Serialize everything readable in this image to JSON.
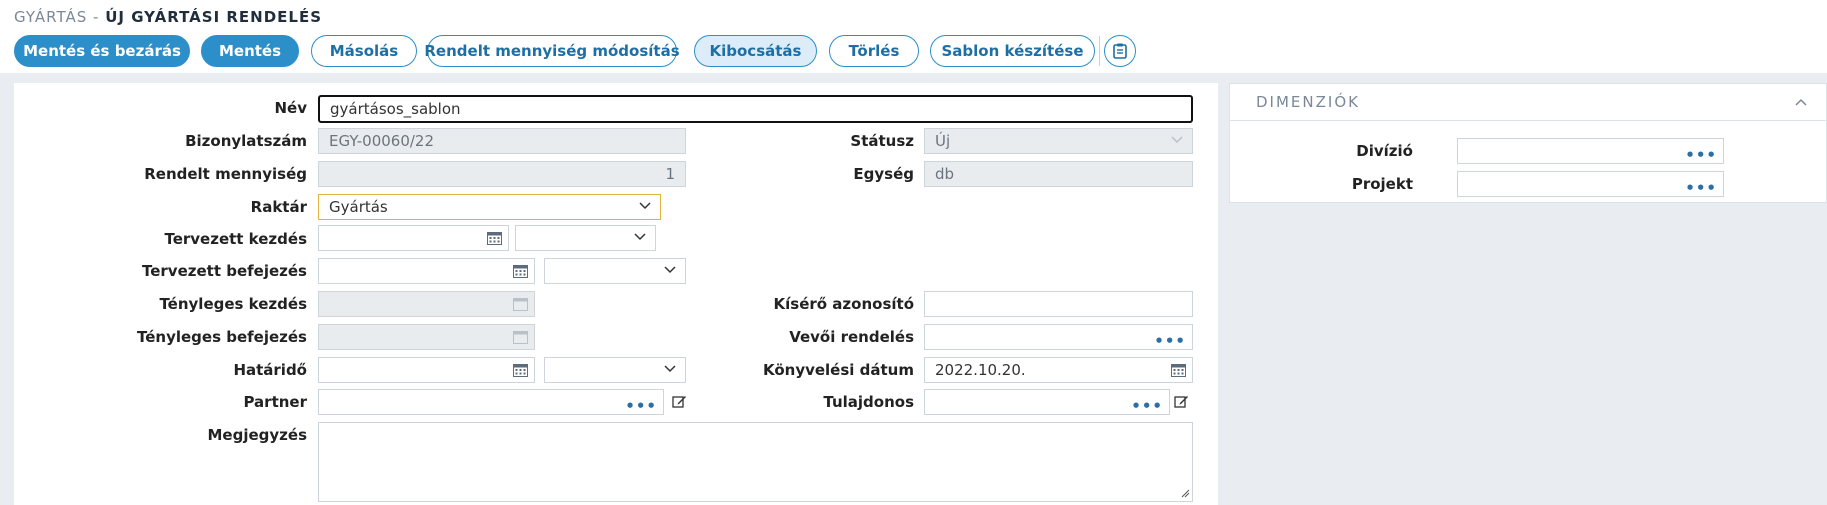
{
  "header": {
    "breadcrumb": "GYÁRTÁS -",
    "title": "ÚJ GYÁRTÁSI RENDELÉS"
  },
  "toolbar": {
    "save_close": "Mentés és bezárás",
    "save": "Mentés",
    "copy": "Másolás",
    "modify_qty": "Rendelt mennyiség módosítás",
    "issue": "Kibocsátás",
    "delete": "Törlés",
    "template": "Sablon készítése",
    "icon": "clipboard-icon"
  },
  "form": {
    "name": {
      "label": "Név",
      "value": "gyártásos_sablon"
    },
    "doc_number": {
      "label": "Bizonylatszám",
      "value": "EGY-00060/22"
    },
    "ordered_qty": {
      "label": "Rendelt mennyiség",
      "value": "1"
    },
    "warehouse": {
      "label": "Raktár",
      "value": "Gyártás"
    },
    "planned_start": {
      "label": "Tervezett kezdés",
      "value": ""
    },
    "planned_end": {
      "label": "Tervezett befejezés",
      "value": ""
    },
    "actual_start": {
      "label": "Tényleges kezdés",
      "value": ""
    },
    "actual_end": {
      "label": "Tényleges befejezés",
      "value": ""
    },
    "deadline": {
      "label": "Határidő",
      "value": ""
    },
    "partner": {
      "label": "Partner",
      "value": ""
    },
    "note": {
      "label": "Megjegyzés",
      "value": ""
    },
    "status": {
      "label": "Státusz",
      "value": "Új"
    },
    "unit": {
      "label": "Egység",
      "value": "db"
    },
    "escort_id": {
      "label": "Kísérő azonosító",
      "value": ""
    },
    "customer_order": {
      "label": "Vevői rendelés",
      "value": ""
    },
    "posting_date": {
      "label": "Könyvelési dátum",
      "value": "2022.10.20."
    },
    "owner": {
      "label": "Tulajdonos",
      "value": ""
    }
  },
  "dimensions": {
    "title": "DIMENZIÓK",
    "division": {
      "label": "Divízió",
      "value": ""
    },
    "project": {
      "label": "Projekt",
      "value": ""
    }
  },
  "colors": {
    "accent": "#2c8fc9",
    "background": "#e9edf1",
    "readonly": "#e9ecef",
    "select_border": "#e3b341"
  }
}
